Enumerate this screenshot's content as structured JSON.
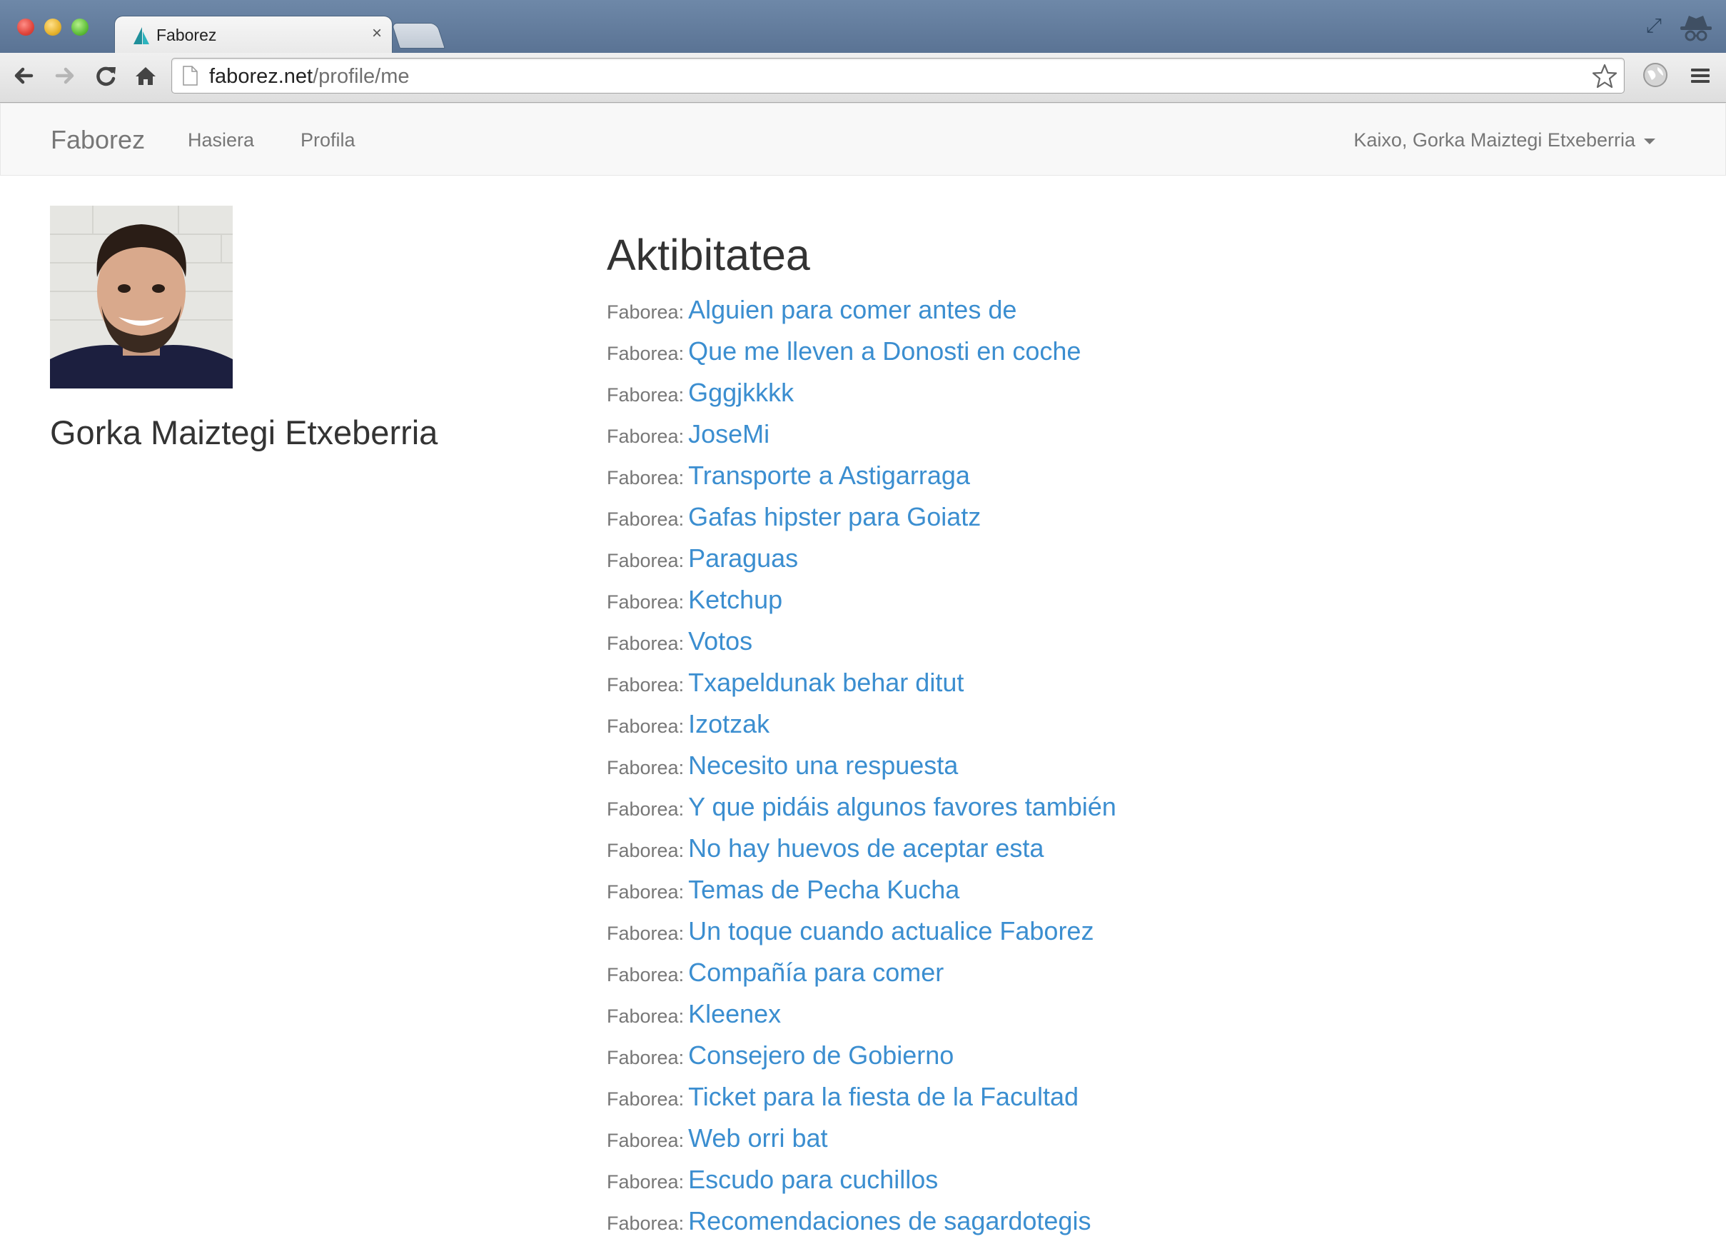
{
  "browser": {
    "tab_title": "Faborez",
    "tab_close": "×",
    "url_host": "faborez.net",
    "url_path": "/profile/me"
  },
  "navbar": {
    "brand": "Faborez",
    "links": [
      "Hasiera",
      "Profila"
    ],
    "user_greeting": "Kaixo, Gorka Maiztegi Etxeberria"
  },
  "profile": {
    "name": "Gorka Maiztegi Etxeberria"
  },
  "activity": {
    "title": "Aktibitatea",
    "prefix": "Faborea:",
    "items": [
      "Alguien para comer antes de",
      "Que me lleven a Donosti en coche",
      "Gggjkkkk",
      "JoseMi",
      "Transporte a Astigarraga",
      "Gafas hipster para Goiatz",
      "Paraguas",
      "Ketchup",
      "Votos",
      "Txapeldunak behar ditut",
      "Izotzak",
      "Necesito una respuesta",
      "Y que pidáis algunos favores también",
      "No hay huevos de aceptar esta",
      "Temas de Pecha Kucha",
      "Un toque cuando actualice Faborez",
      "Compañía para comer",
      "Kleenex",
      "Consejero de Gobierno",
      "Ticket para la fiesta de la Facultad",
      "Web orri bat",
      "Escudo para cuchillos",
      "Recomendaciones de sagardotegis"
    ]
  },
  "colors": {
    "link": "#3b8ed0",
    "muted": "#777777",
    "heading": "#333333",
    "navbar_bg": "#f8f8f8"
  }
}
